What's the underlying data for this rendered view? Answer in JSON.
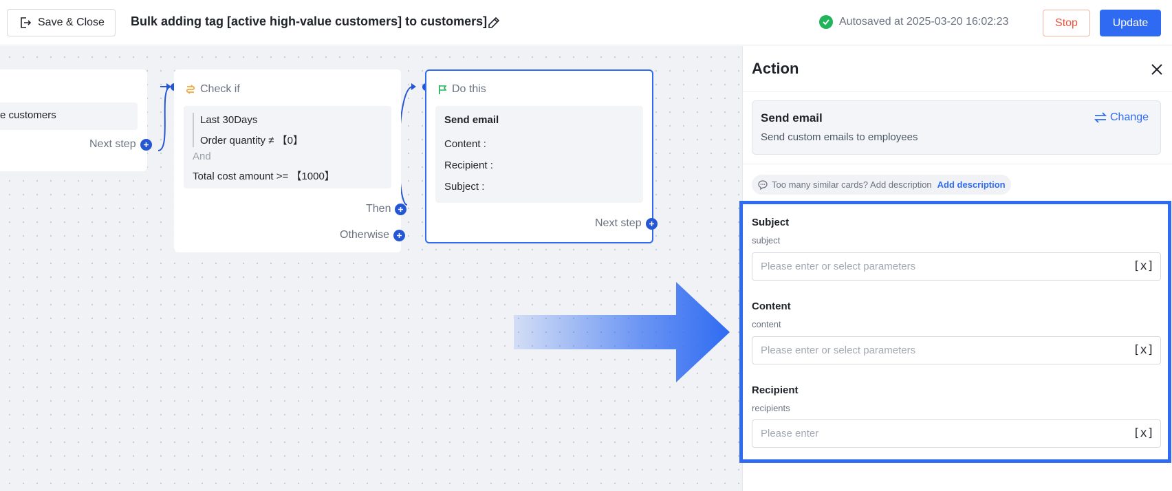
{
  "header": {
    "save_close_label": "Save & Close",
    "title": "Bulk adding tag [active high-value customers] to customers]",
    "autosave_text": "Autosaved at 2025-03-20 16:02:23",
    "stop_label": "Stop",
    "update_label": "Update"
  },
  "canvas": {
    "card_a": {
      "title_fragment": "n",
      "inner_text": "e customers",
      "next_step_label": "Next step"
    },
    "card_b": {
      "title": "Check if",
      "conditions": [
        "Last 30Days",
        "Order quantity ≠ 【0】"
      ],
      "joiner": "And",
      "extra_condition": "Total cost amount >= 【1000】",
      "then_label": "Then",
      "otherwise_label": "Otherwise"
    },
    "card_c": {
      "title": "Do this",
      "action_title": "Send email",
      "rows": [
        "Content :",
        "Recipient :",
        "Subject :"
      ],
      "next_step_label": "Next step"
    }
  },
  "panel": {
    "title": "Action",
    "action": {
      "name": "Send email",
      "description": "Send custom emails to employees",
      "change_label": "Change"
    },
    "description_hint": "Too many similar cards? Add description",
    "add_description_label": "Add description",
    "fields": [
      {
        "label": "Subject",
        "key": "subject",
        "placeholder": "Please enter or select parameters",
        "param_icon": "[x]"
      },
      {
        "label": "Content",
        "key": "content",
        "placeholder": "Please enter or select parameters",
        "param_icon": "[x]"
      },
      {
        "label": "Recipient",
        "key": "recipients",
        "placeholder": "Please enter",
        "param_icon": "[x]"
      }
    ]
  },
  "colors": {
    "accent": "#2f6bf2",
    "node_blue": "#2556d4",
    "success": "#22b45a",
    "stop": "#e8543a"
  }
}
